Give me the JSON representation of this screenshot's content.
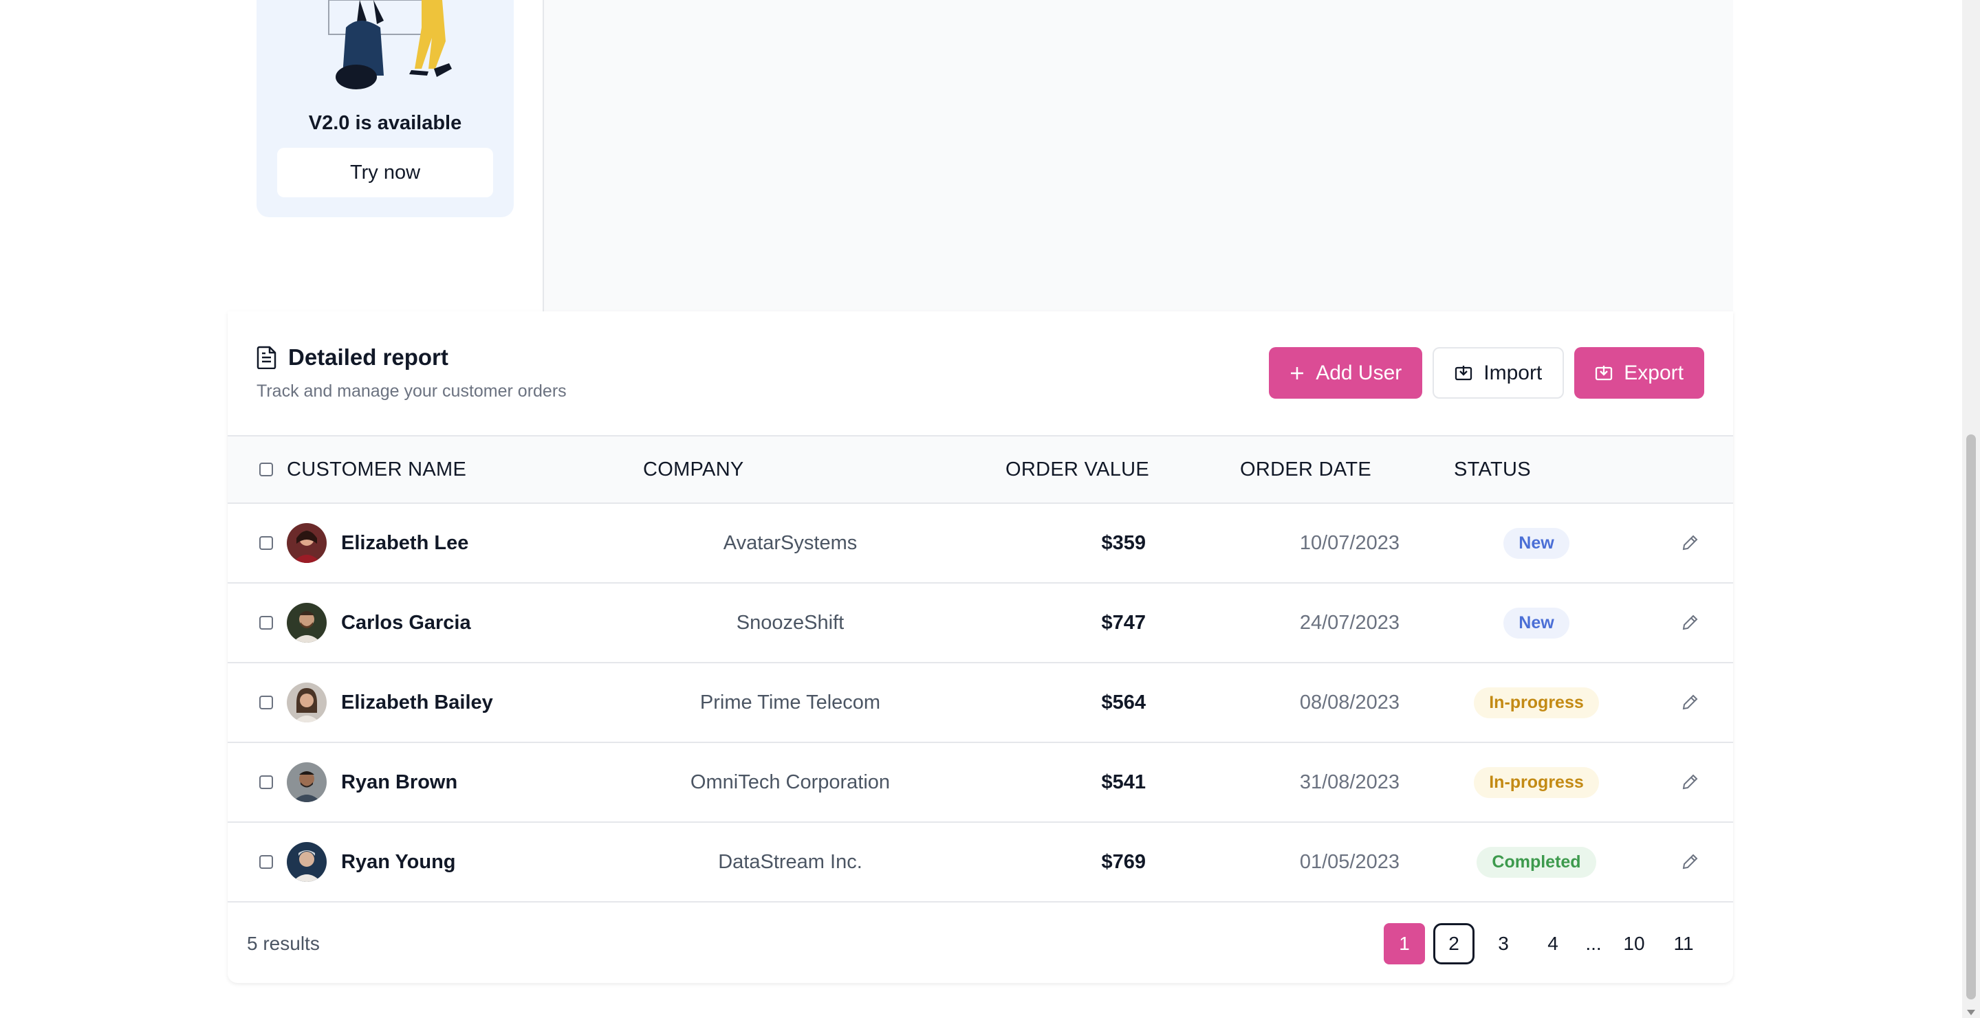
{
  "promo": {
    "title": "V2.0 is available",
    "button_label": "Try now"
  },
  "report": {
    "title": "Detailed report",
    "subtitle": "Track and manage your customer orders",
    "icon": "document-icon",
    "actions": {
      "add_user": "Add User",
      "import": "Import",
      "export": "Export"
    },
    "columns": {
      "customer_name": "CUSTOMER NAME",
      "company": "COMPANY",
      "order_value": "ORDER VALUE",
      "order_date": "ORDER DATE",
      "status": "STATUS"
    },
    "rows": [
      {
        "name": "Elizabeth Lee",
        "company": "AvatarSystems",
        "value": "$359",
        "date": "10/07/2023",
        "status": "New"
      },
      {
        "name": "Carlos Garcia",
        "company": "SnoozeShift",
        "value": "$747",
        "date": "24/07/2023",
        "status": "New"
      },
      {
        "name": "Elizabeth Bailey",
        "company": "Prime Time Telecom",
        "value": "$564",
        "date": "08/08/2023",
        "status": "In-progress"
      },
      {
        "name": "Ryan Brown",
        "company": "OmniTech Corporation",
        "value": "$541",
        "date": "31/08/2023",
        "status": "In-progress"
      },
      {
        "name": "Ryan Young",
        "company": "DataStream Inc.",
        "value": "$769",
        "date": "01/05/2023",
        "status": "Completed"
      }
    ],
    "results_text": "5 results",
    "pagination": [
      "1",
      "2",
      "3",
      "4",
      "...",
      "10",
      "11"
    ],
    "current_page": "1"
  },
  "colors": {
    "accent": "#db4c95",
    "status_new": "#4b6fd6",
    "status_in_progress": "#c38a14",
    "status_completed": "#3d9a4d"
  }
}
